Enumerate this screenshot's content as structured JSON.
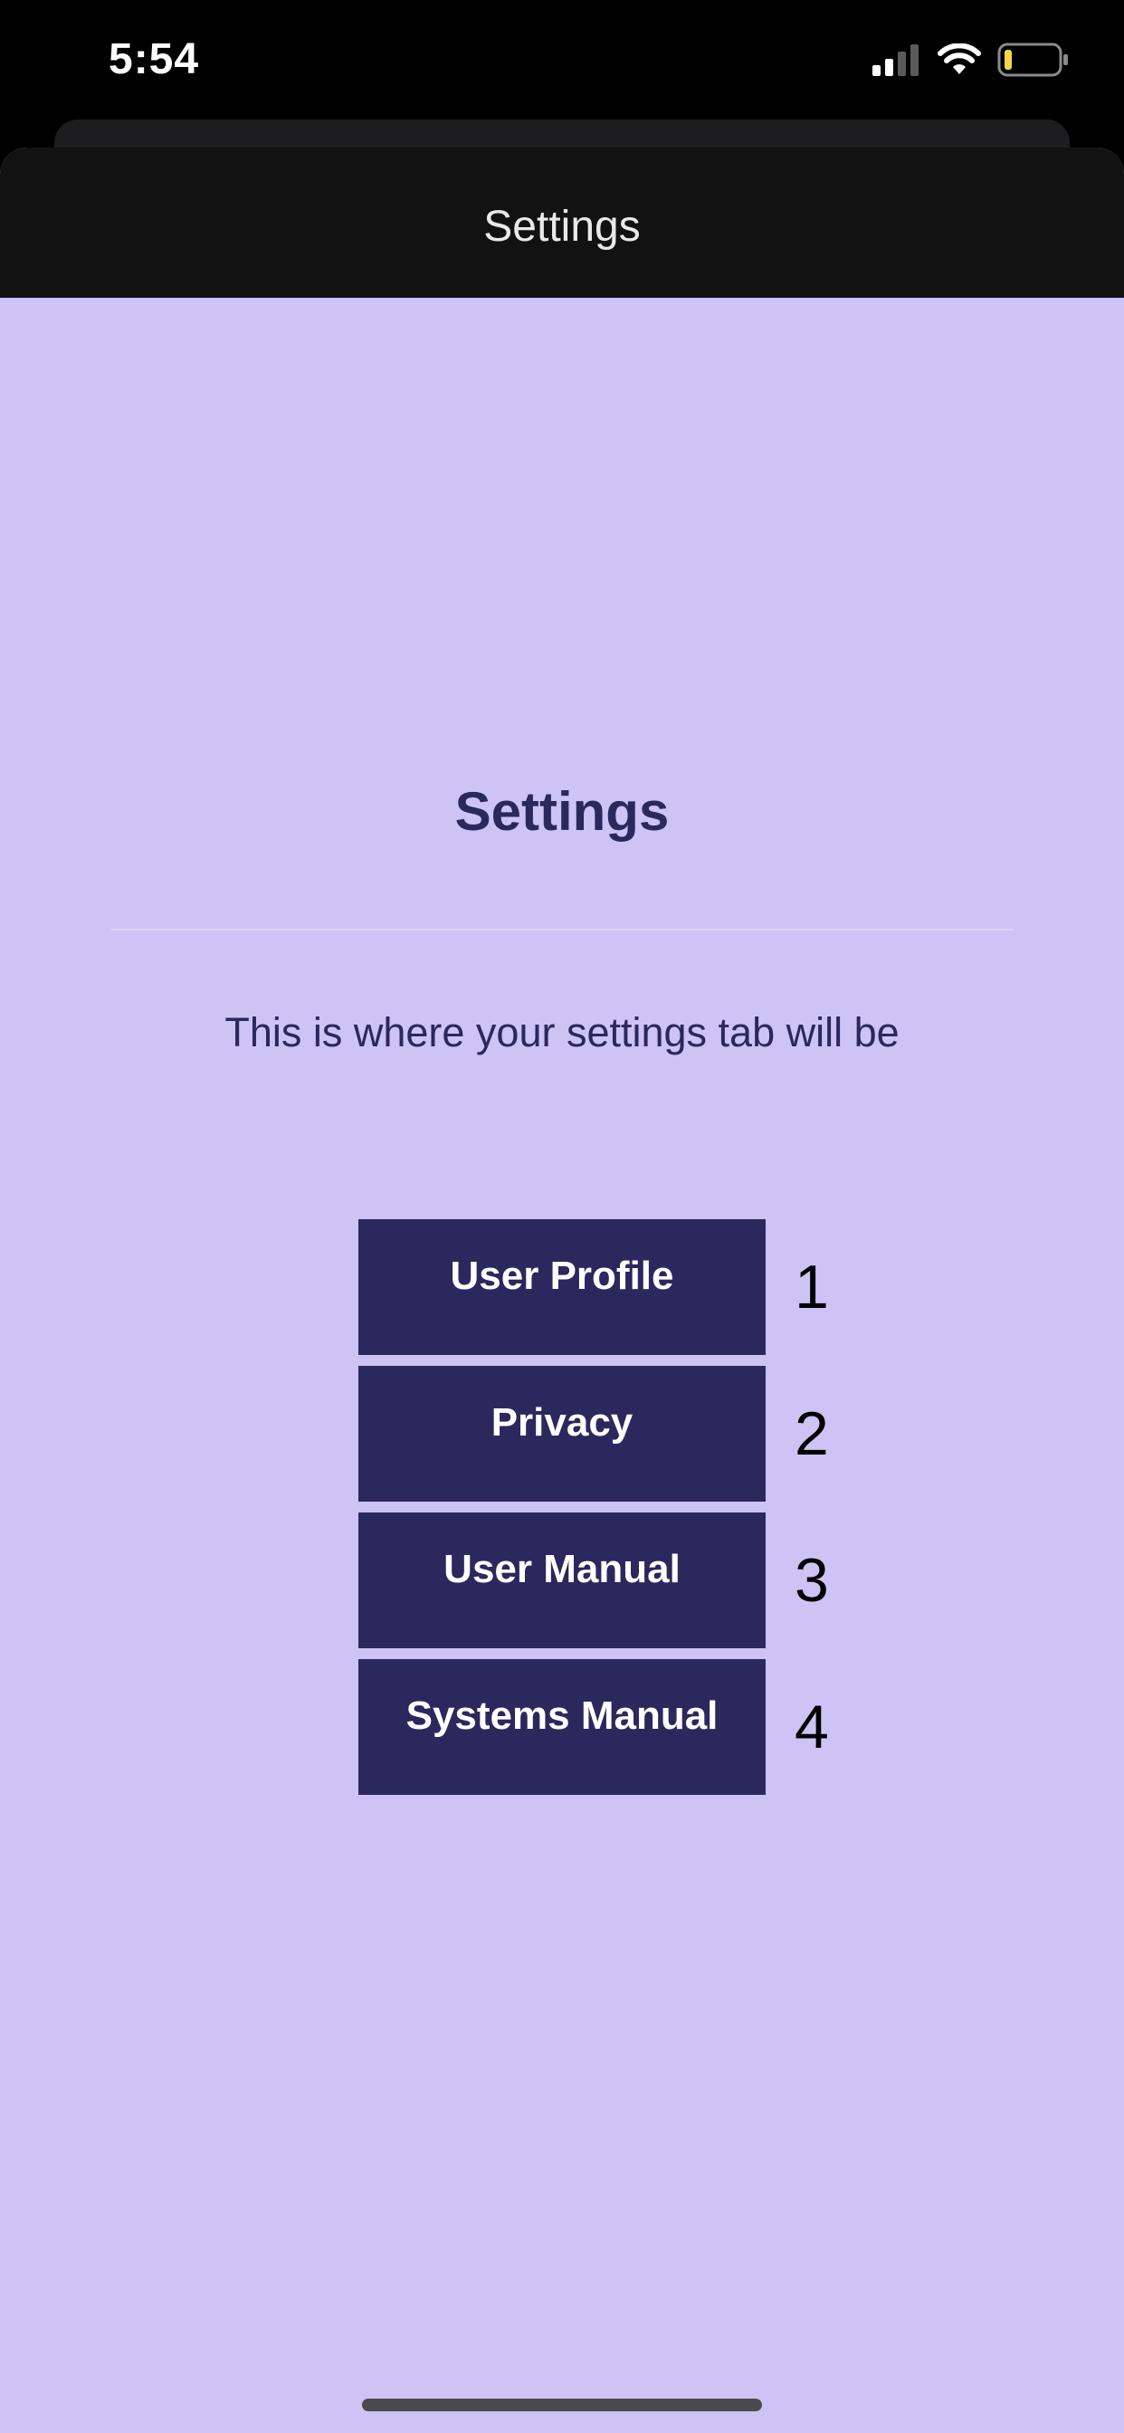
{
  "status_bar": {
    "time": "5:54",
    "icons": [
      "cellular-signal-icon",
      "wifi-icon",
      "battery-icon"
    ],
    "battery_level": 0.15
  },
  "nav": {
    "title": "Settings"
  },
  "page": {
    "title": "Settings",
    "subtitle": "This is where your settings tab will be"
  },
  "menu": {
    "items": [
      {
        "label": "User Profile",
        "number": "1"
      },
      {
        "label": "Privacy",
        "number": "2"
      },
      {
        "label": "User Manual",
        "number": "3"
      },
      {
        "label": "Systems Manual",
        "number": "4"
      }
    ]
  },
  "colors": {
    "background": "#cdc4f5",
    "button": "#2b285e",
    "nav_bar": "#121212",
    "battery_fill": "#f2d64b"
  }
}
